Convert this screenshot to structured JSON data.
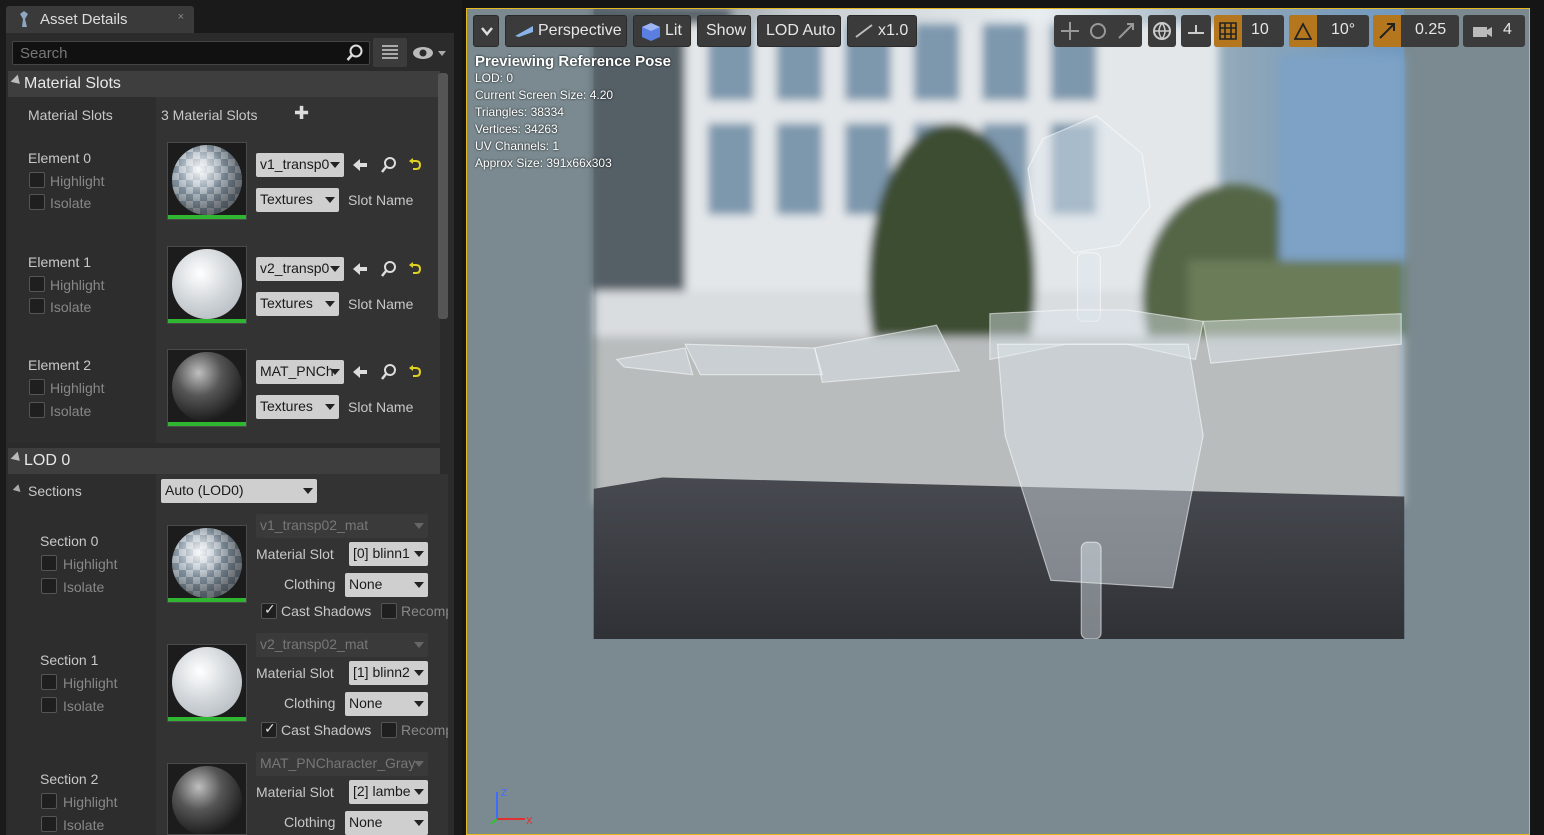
{
  "tab": {
    "title": "Asset Details",
    "close": "×"
  },
  "search": {
    "placeholder": "Search"
  },
  "material_slots": {
    "header": "Material Slots",
    "row_label": "Material Slots",
    "count": "3 Material Slots",
    "add": "✚",
    "elements": [
      {
        "label": "Element 0",
        "highlight": "Highlight",
        "isolate": "Isolate",
        "material": "v1_transp0",
        "textures": "Textures",
        "slot_name": "Slot Name"
      },
      {
        "label": "Element 1",
        "highlight": "Highlight",
        "isolate": "Isolate",
        "material": "v2_transp0",
        "textures": "Textures",
        "slot_name": "Slot Name"
      },
      {
        "label": "Element 2",
        "highlight": "Highlight",
        "isolate": "Isolate",
        "material": "MAT_PNCh",
        "textures": "Textures",
        "slot_name": "Slot Name"
      }
    ]
  },
  "lod0": {
    "header": "LOD 0",
    "sections_label": "Sections",
    "lod_combo": "Auto (LOD0)",
    "sections": [
      {
        "label": "Section 0",
        "highlight": "Highlight",
        "isolate": "Isolate",
        "material": "v1_transp02_mat",
        "material_slot_label": "Material Slot",
        "material_slot": "[0] blinn1",
        "clothing_label": "Clothing",
        "clothing": "None",
        "cast_shadows": "Cast Shadows",
        "recompute": "Recomp"
      },
      {
        "label": "Section 1",
        "highlight": "Highlight",
        "isolate": "Isolate",
        "material": "v2_transp02_mat",
        "material_slot_label": "Material Slot",
        "material_slot": "[1] blinn2",
        "clothing_label": "Clothing",
        "clothing": "None",
        "cast_shadows": "Cast Shadows",
        "recompute": "Recomp"
      },
      {
        "label": "Section 2",
        "highlight": "Highlight",
        "isolate": "Isolate",
        "material": "MAT_PNCharacter_Gray",
        "material_slot_label": "Material Slot",
        "material_slot": "[2] lambe",
        "clothing_label": "Clothing",
        "clothing": "None"
      }
    ]
  },
  "toolbar": {
    "perspective": "Perspective",
    "lit": "Lit",
    "show": "Show",
    "lod": "LOD Auto",
    "speed": "x1.0",
    "grid_snap": "10",
    "rot_snap": "10°",
    "scale_snap": "0.25",
    "camera_speed": "4"
  },
  "overlay": {
    "title": "Previewing Reference Pose",
    "lod": "LOD: 0",
    "screen_size": "Current Screen Size: 4.20",
    "triangles": "Triangles: 38334",
    "vertices": "Vertices: 34263",
    "uv_channels": "UV Channels: 1",
    "approx_size": "Approx Size: 391x66x303"
  },
  "colors": {
    "accent_orange": "#b5771d",
    "selection_yellow": "#e6b820",
    "green_bar": "#2fb52f"
  }
}
